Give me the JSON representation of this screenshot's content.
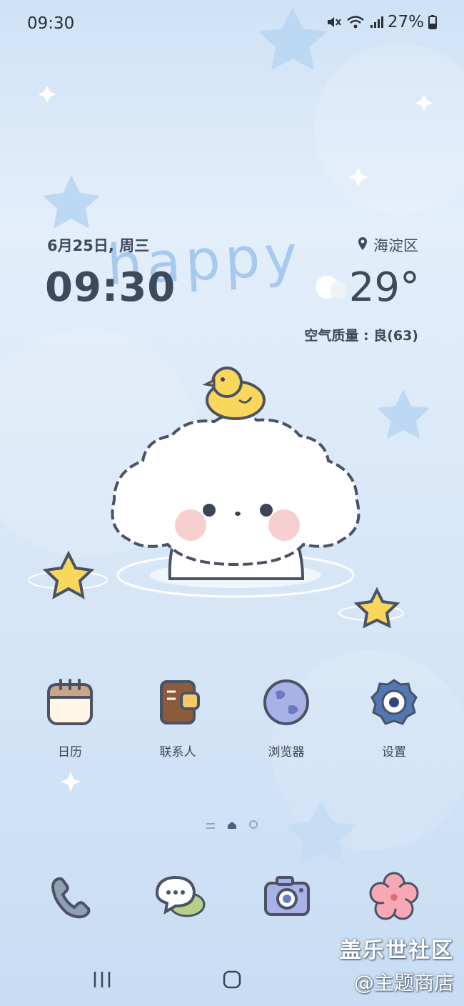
{
  "status_bar": {
    "time": "09:30",
    "battery": "27%"
  },
  "widget": {
    "date": "6月25日, 周三",
    "time": "09:30",
    "location": "海淀区",
    "temperature": "29°",
    "air_quality": "空气质量 : 良(63)",
    "wallpaper_text": "happy"
  },
  "apps": [
    {
      "label": "日历",
      "icon": "calendar-icon"
    },
    {
      "label": "联系人",
      "icon": "contacts-icon"
    },
    {
      "label": "浏览器",
      "icon": "browser-icon"
    },
    {
      "label": "设置",
      "icon": "settings-icon"
    }
  ],
  "dock": [
    {
      "icon": "phone-icon"
    },
    {
      "icon": "messages-icon"
    },
    {
      "icon": "camera-icon"
    },
    {
      "icon": "flower-icon"
    }
  ],
  "watermark": {
    "line1": "盖乐世社区",
    "line2": "@主题商店"
  }
}
